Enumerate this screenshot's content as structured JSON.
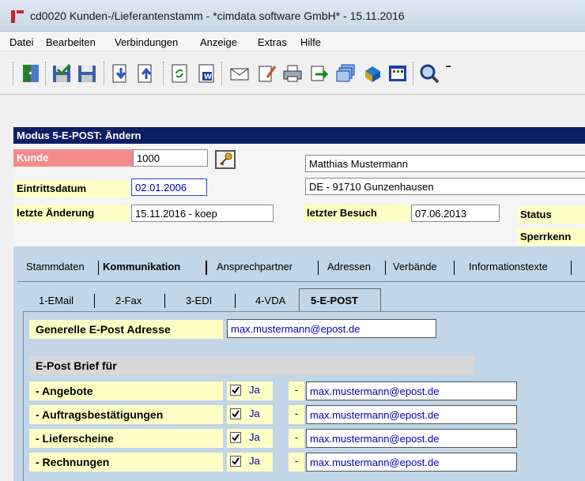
{
  "window": {
    "title": "cd0020 Kunden-/Lieferantenstamm - *cimdata software GmbH* - 15.11.2016"
  },
  "menu": {
    "items": [
      "Datei",
      "Bearbeiten",
      "Verbindungen",
      "Anzeige",
      "Extras",
      "Hilfe"
    ]
  },
  "toolbar": {
    "buttons": [
      "exit-icon",
      "save-check-icon",
      "save-icon",
      "arrow-down-icon",
      "arrow-up-icon",
      "refresh-icon",
      "word-icon",
      "envelope-icon",
      "edit-document-icon",
      "printer-icon",
      "transfer-icon",
      "windows-icon",
      "book-icon",
      "calculator-icon",
      "search-icon"
    ]
  },
  "mode": {
    "title": "Modus 5-E-POST: Ändern"
  },
  "header": {
    "kunde_label": "Kunde",
    "kunde_value": "1000",
    "name_value": "Matthias Mustermann",
    "address_value": "DE - 91710 Gunzenhausen",
    "eintritt_label": "Eintrittsdatum",
    "eintritt_value": "02.01.2006",
    "aenderung_label": "letzte Änderung",
    "aenderung_value": "15.11.2016 - koep",
    "besuch_label": "letzter Besuch",
    "besuch_value": "07.06.2013",
    "status_label": "Status",
    "sperr_label": "Sperrkenn"
  },
  "tabs": {
    "main": [
      {
        "label": "Stammdaten"
      },
      {
        "label": "Kommunikation",
        "active": true
      },
      {
        "label": "Ansprechpartner"
      },
      {
        "label": "Adressen"
      },
      {
        "label": "Verbände"
      },
      {
        "label": "Informationstexte"
      }
    ],
    "sub": [
      {
        "label": "1-EMail"
      },
      {
        "label": "2-Fax"
      },
      {
        "label": "3-EDI"
      },
      {
        "label": "4-VDA"
      },
      {
        "label": "5-E-POST",
        "active": true
      }
    ]
  },
  "epost": {
    "general_label": "Generelle E-Post Adresse",
    "general_value": "max.mustermann@epost.de",
    "section_title": "E-Post Brief für",
    "rows": [
      {
        "label": "- Angebote",
        "checked": true,
        "check_label": "Ja",
        "dash": "-",
        "email": "max.mustermann@epost.de"
      },
      {
        "label": "- Auftragsbestätigungen",
        "checked": true,
        "check_label": "Ja",
        "dash": "-",
        "email": "max.mustermann@epost.de"
      },
      {
        "label": "- Lieferscheine",
        "checked": true,
        "check_label": "Ja",
        "dash": "-",
        "email": "max.mustermann@epost.de"
      },
      {
        "label": "- Rechnungen",
        "checked": true,
        "check_label": "Ja",
        "dash": "-",
        "email": "max.mustermann@epost.de"
      }
    ]
  },
  "colors": {
    "mode_bar": "#0b1f66",
    "kunde_label_bg": "#f28b8b",
    "yellow_label_bg": "#ffffc6",
    "panel_bg": "#c1d6e6",
    "email_text": "#0000b5"
  }
}
